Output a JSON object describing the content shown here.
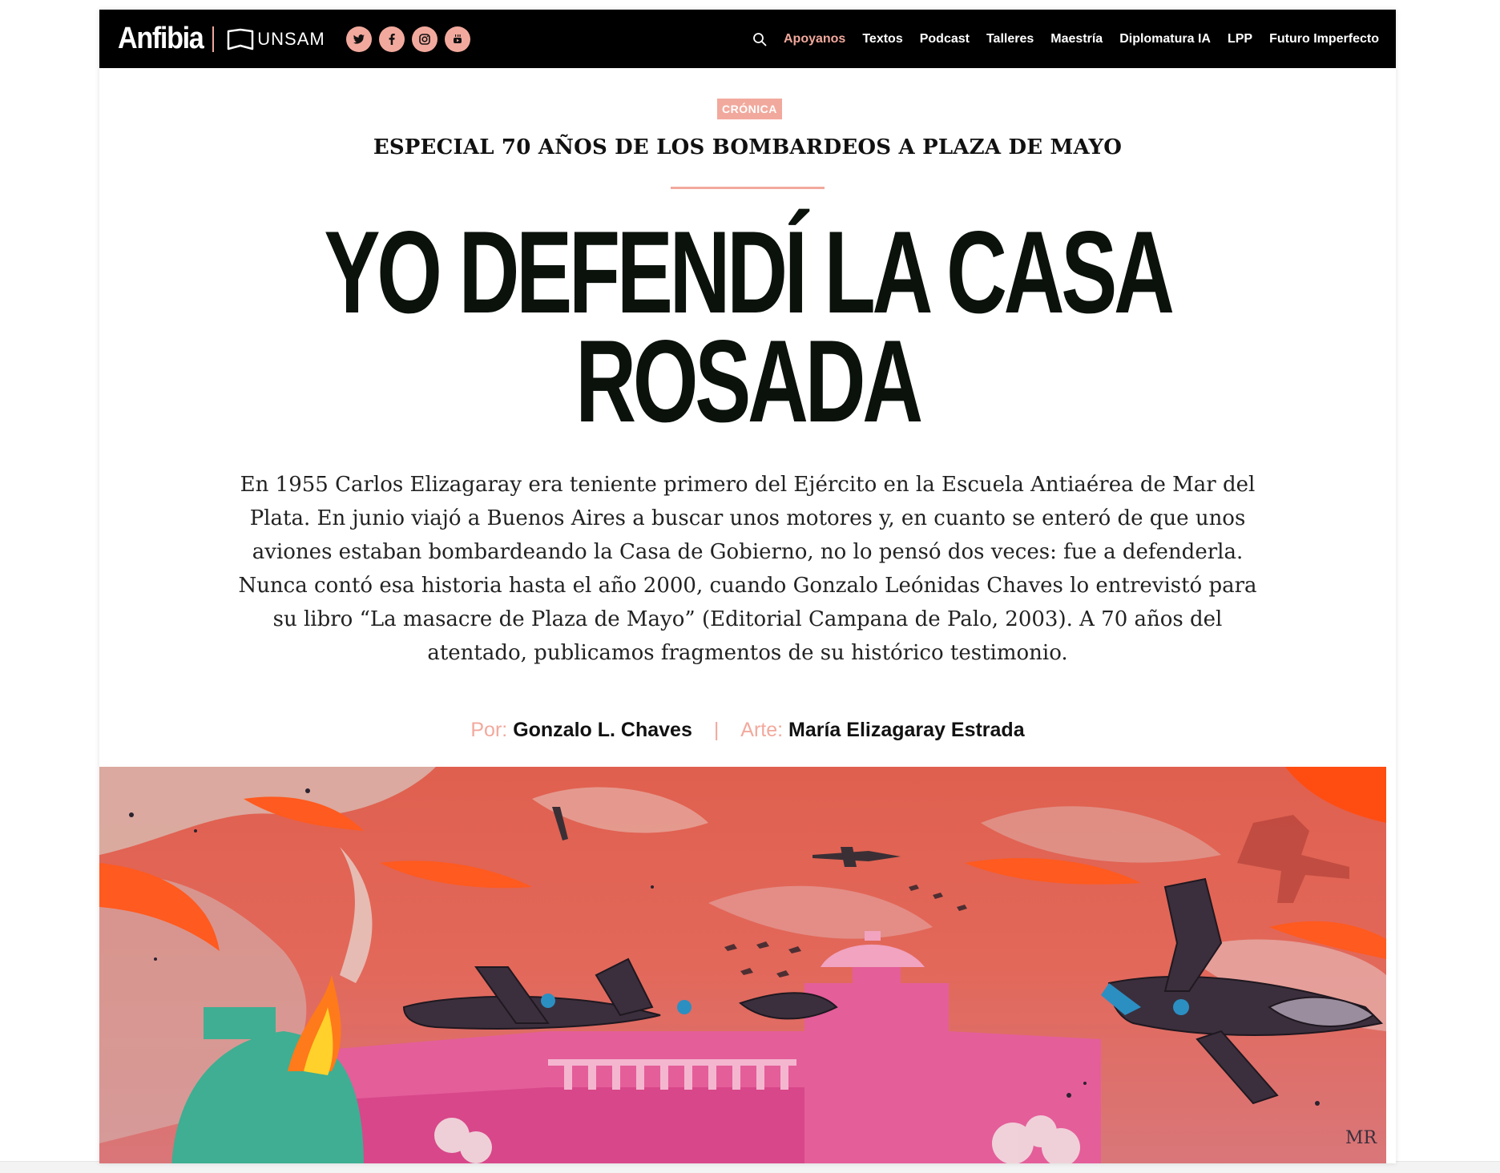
{
  "nav": {
    "logo": "Anfibia",
    "partner": "UNSAM",
    "socials": [
      "twitter-icon",
      "facebook-icon",
      "instagram-icon",
      "youtube-icon"
    ],
    "items": [
      "Apoyanos",
      "Textos",
      "Podcast",
      "Talleres",
      "Maestría",
      "Diplomatura IA",
      "LPP",
      "Futuro Imperfecto"
    ],
    "active": "Apoyanos"
  },
  "article": {
    "section": "CRÓNICA",
    "kicker": "ESPECIAL 70 AÑOS DE LOS BOMBARDEOS A PLAZA DE MAYO",
    "title_line1": "YO DEFENDÍ LA CASA",
    "title_line2": "ROSADA",
    "lede": "En 1955 Carlos Elizagaray era teniente primero del Ejército en la Escuela Antiaérea de Mar del Plata. En junio viajó a Buenos Aires a buscar unos motores y, en cuanto se enteró de que unos aviones estaban bombardeando la Casa de Gobierno, no lo pensó dos veces: fue a defenderla. Nunca contó esa historia hasta el año 2000, cuando Gonzalo Leónidas Chaves lo entrevistó para su libro “La masacre de Plaza de Mayo” (Editorial Campana de Palo, 2003). A 70 años del atentado, publicamos fragmentos de su histórico testimonio.",
    "byline": {
      "author_label": "Por:",
      "author": "Gonzalo L. Chaves",
      "separator": "|",
      "art_label": "Arte:",
      "artist": "María Elizagaray Estrada"
    },
    "hero_signature": "MR"
  },
  "colors": {
    "accent": "#f2a99d",
    "nav_bg": "#000000",
    "title": "#0b120c"
  }
}
